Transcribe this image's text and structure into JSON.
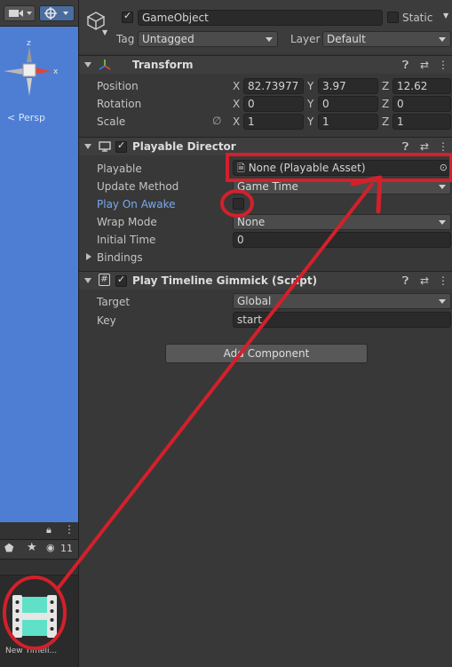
{
  "scene": {
    "persp_label": "< Persp",
    "gizmo": {
      "y": "y",
      "x": "x",
      "z": "z"
    }
  },
  "project": {
    "hidden_count": "11",
    "asset_label": "New Timeli..."
  },
  "inspector": {
    "object_name": "GameObject",
    "static_label": "Static",
    "tag_label": "Tag",
    "tag_value": "Untagged",
    "layer_label": "Layer",
    "layer_value": "Default"
  },
  "transform": {
    "title": "Transform",
    "position_label": "Position",
    "rotation_label": "Rotation",
    "scale_label": "Scale",
    "axis_x": "X",
    "axis_y": "Y",
    "axis_z": "Z",
    "position": {
      "x": "82.73977",
      "y": "3.97",
      "z": "12.62"
    },
    "rotation": {
      "x": "0",
      "y": "0",
      "z": "0"
    },
    "scale": {
      "x": "1",
      "y": "1",
      "z": "1"
    }
  },
  "playable_director": {
    "title": "Playable Director",
    "playable_label": "Playable",
    "playable_value": "None (Playable Asset)",
    "update_method_label": "Update Method",
    "update_method_value": "Game Time",
    "play_on_awake_label": "Play On Awake",
    "play_on_awake_checked": false,
    "wrap_mode_label": "Wrap Mode",
    "wrap_mode_value": "None",
    "initial_time_label": "Initial Time",
    "initial_time_value": "0",
    "bindings_label": "Bindings"
  },
  "script_component": {
    "title": "Play Timeline Gimmick (Script)",
    "target_label": "Target",
    "target_value": "Global",
    "key_label": "Key",
    "key_value": "start"
  },
  "add_component_label": "Add Component",
  "colors": {
    "annotation_red": "#d3202b",
    "scene_blue": "#4d7ed4",
    "highlight_label": "#79a9ef"
  }
}
